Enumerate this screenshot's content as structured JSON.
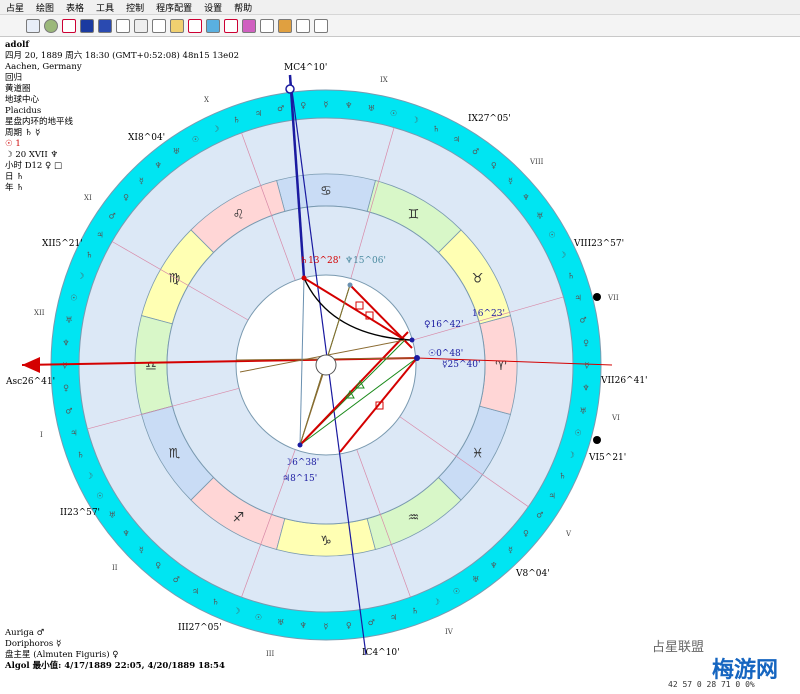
{
  "menu": [
    "占星",
    "绘图",
    "表格",
    "工具",
    "控制",
    "程序配置",
    "设置",
    "帮助"
  ],
  "header": {
    "name": "adolf",
    "datetime": "四月 20, 1889 周六 18:30 (GMT+0:52:08) 48n15 13e02",
    "place": "Aachen, Germany"
  },
  "info_lines": [
    "回归",
    "黄道圈",
    "地球中心",
    "Placidus",
    "星盘内环的地平线",
    "周期 ♄ ☿",
    "☉ 1",
    "☽ 20 XVII ♆",
    "小时 D12 ♀ □",
    "日 ♄",
    "年 ♄"
  ],
  "bottom": {
    "line1": "Auriga ♂",
    "line2": "Doriphoros ☿",
    "line3": "盘主星 (Almuten Figuris) ♀",
    "algol": "Algol 最小值: 4/17/1889 22:05,  4/20/1889 18:54"
  },
  "watermark": "占星联盟",
  "watermark2": "梅游网",
  "corner_text": "42 57 0  28 71 0  0%",
  "houses": {
    "MC": "MC4^10'",
    "IX": "IX27^05'",
    "VIII": "VIII23^57'",
    "VII": "VII26^41'",
    "VI": "VI5^21'",
    "V": "V8^04'",
    "IC": "IC4^10'",
    "III": "III27^05'",
    "II": "II23^57'",
    "Asc": "Asc26^41'",
    "XII": "XII5^21'",
    "XI": "XI8^04'"
  },
  "house_numerals": [
    "IX",
    "VIII",
    "VII",
    "VI",
    "V",
    "IV",
    "III",
    "II",
    "I",
    "XII",
    "XI",
    "X"
  ],
  "planet_labels": {
    "saturn": "♄13^28'",
    "neptune": "♆15^06'",
    "venus": "♀16^42'",
    "mercury2": "16^23'",
    "sun": "☉0^48'",
    "mercury": "☿25^40'",
    "moon": "☽6^38'",
    "jupiter": "♃8^15'"
  },
  "colors": {
    "outer_ring": "#00e5f2",
    "inner_bg": "#dce8f6",
    "fire": "#ffd6d6",
    "earth": "#ffffb3",
    "air": "#d8f7c8",
    "water": "#c9dcf5",
    "red_line": "#d40000",
    "blue_line": "#1a1aa0"
  }
}
